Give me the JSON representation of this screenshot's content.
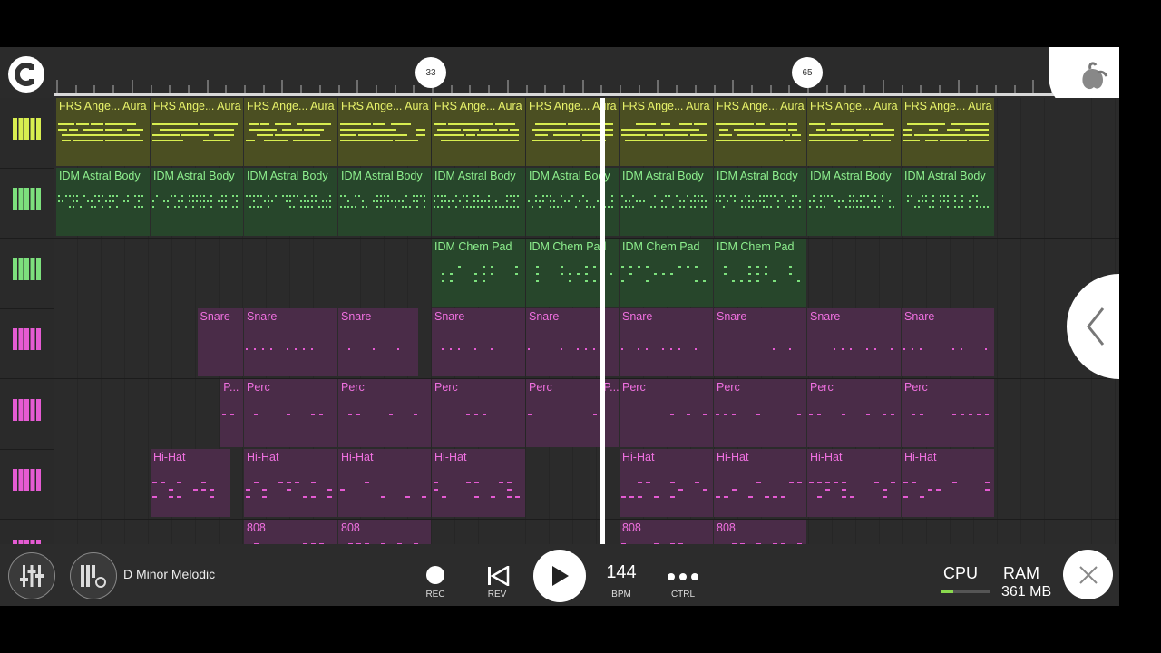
{
  "ruler": {
    "markers": [
      "33",
      "65"
    ]
  },
  "tracks": [
    {
      "color": "#d8ee50",
      "clip_bg": "#4b4f22",
      "label_color": "#e8f36a",
      "icon": "piano-icon",
      "clips": [
        {
          "label": "FRS Ange... Aura"
        },
        {
          "label": "FRS Ange... Aura"
        },
        {
          "label": "FRS Ange... Aura"
        },
        {
          "label": "FRS Ange... Aura"
        },
        {
          "label": "FRS Ange... Aura"
        },
        {
          "label": "FRS Ange... Aura"
        },
        {
          "label": "FRS Ange... Aura"
        },
        {
          "label": "FRS Ange... Aura"
        },
        {
          "label": "FRS Ange... Aura"
        },
        {
          "label": "FRS Ange... Aura"
        }
      ]
    },
    {
      "color": "#7de07d",
      "clip_bg": "#27462b",
      "label_color": "#8ef08e",
      "icon": "piano-icon",
      "clips": [
        {
          "label": "IDM Astral Body"
        },
        {
          "label": "IDM Astral Body"
        },
        {
          "label": "IDM Astral Body"
        },
        {
          "label": "IDM Astral Body"
        },
        {
          "label": "IDM Astral Body"
        },
        {
          "label": "IDM Astral Body"
        },
        {
          "label": "IDM Astral Body"
        },
        {
          "label": "IDM Astral Body"
        },
        {
          "label": "IDM Astral Body"
        },
        {
          "label": "IDM Astral Body"
        }
      ]
    },
    {
      "color": "#7de07d",
      "clip_bg": "#27462b",
      "label_color": "#8ef08e",
      "icon": "piano-icon",
      "clips": [
        {
          "label": "IDM Chem Pad"
        },
        {
          "label": "IDM Chem Pad"
        },
        {
          "label": "IDM Chem Pad"
        },
        {
          "label": "IDM Chem Pad"
        }
      ]
    },
    {
      "color": "#e55bd3",
      "clip_bg": "#4a2c48",
      "label_color": "#f070e0",
      "icon": "piano-icon",
      "clips": [
        {
          "label": "Snare"
        },
        {
          "label": "Snare"
        },
        {
          "label": "Snare"
        },
        {
          "label": "Snare"
        },
        {
          "label": "Snare"
        },
        {
          "label": "Snare"
        },
        {
          "label": "Snare"
        },
        {
          "label": "Snare"
        },
        {
          "label": "Snare"
        }
      ]
    },
    {
      "color": "#e55bd3",
      "clip_bg": "#4a2c48",
      "label_color": "#f070e0",
      "icon": "piano-icon",
      "clips": [
        {
          "label": "P..."
        },
        {
          "label": "Perc"
        },
        {
          "label": "Perc"
        },
        {
          "label": "Perc"
        },
        {
          "label": "Perc"
        },
        {
          "label": "P..."
        },
        {
          "label": "Perc"
        },
        {
          "label": "Perc"
        },
        {
          "label": "Perc"
        },
        {
          "label": "Perc"
        }
      ]
    },
    {
      "color": "#e55bd3",
      "clip_bg": "#4a2c48",
      "label_color": "#f070e0",
      "icon": "piano-icon",
      "clips": [
        {
          "label": "Hi-Hat"
        },
        {
          "label": "Hi-Hat"
        },
        {
          "label": "Hi-Hat"
        },
        {
          "label": "Hi-Hat"
        },
        {
          "label": "Hi-Hat"
        },
        {
          "label": "Hi-Hat"
        },
        {
          "label": "Hi-Hat"
        },
        {
          "label": "Hi-Hat"
        }
      ]
    },
    {
      "color": "#e55bd3",
      "clip_bg": "#4a2c48",
      "label_color": "#f070e0",
      "icon": "piano-icon",
      "clips": [
        {
          "label": "808"
        },
        {
          "label": "808"
        },
        {
          "label": "808"
        },
        {
          "label": "808"
        }
      ]
    }
  ],
  "transport": {
    "song_name": "D Minor Melodic",
    "rec_label": "REC",
    "rev_label": "REV",
    "bpm_value": "144",
    "bpm_label": "BPM",
    "ctrl_label": "CTRL"
  },
  "status": {
    "cpu_label": "CPU",
    "cpu_load": 0.25,
    "ram_label": "RAM",
    "ram_value": "361 MB"
  },
  "icons": {
    "mixer": "mixer-icon",
    "channel_rack": "channel-rack-icon",
    "magnet": "magnet-icon",
    "logo": "fl-fruit-logo",
    "collapse": "chevron-left-icon",
    "close": "close-icon",
    "record": "record-icon",
    "rewind": "rewind-icon",
    "play": "play-icon",
    "more": "more-dots-icon"
  }
}
